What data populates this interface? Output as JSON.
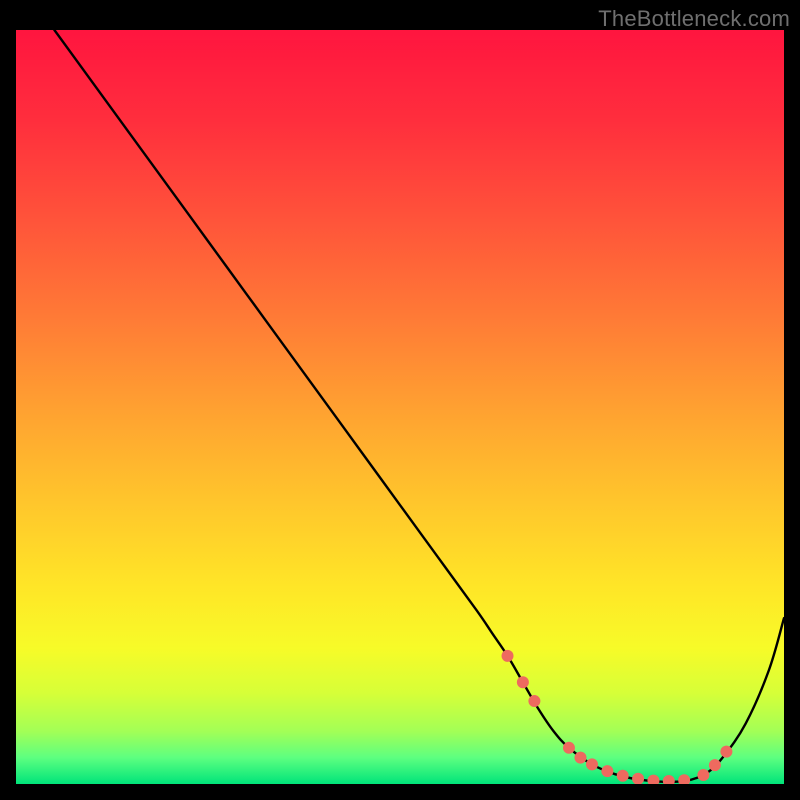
{
  "watermark": "TheBottleneck.com",
  "chart_data": {
    "type": "line",
    "title": "",
    "xlabel": "",
    "ylabel": "",
    "xlim": [
      0,
      100
    ],
    "ylim": [
      0,
      100
    ],
    "grid": false,
    "legend": false,
    "background_gradient": {
      "stops": [
        {
          "offset": 0.0,
          "color": "#ff153f"
        },
        {
          "offset": 0.12,
          "color": "#ff2e3d"
        },
        {
          "offset": 0.25,
          "color": "#ff533a"
        },
        {
          "offset": 0.38,
          "color": "#ff7a36"
        },
        {
          "offset": 0.5,
          "color": "#ffa031"
        },
        {
          "offset": 0.62,
          "color": "#ffc42c"
        },
        {
          "offset": 0.74,
          "color": "#ffe627"
        },
        {
          "offset": 0.82,
          "color": "#f7fb28"
        },
        {
          "offset": 0.88,
          "color": "#d6ff38"
        },
        {
          "offset": 0.93,
          "color": "#a3ff56"
        },
        {
          "offset": 0.965,
          "color": "#5dff80"
        },
        {
          "offset": 1.0,
          "color": "#00e47a"
        }
      ]
    },
    "series": [
      {
        "name": "bottleneck-curve",
        "stroke": "#000000",
        "stroke_width": 2.4,
        "x": [
          5,
          10,
          15,
          20,
          25,
          30,
          35,
          40,
          45,
          50,
          55,
          60,
          62,
          64,
          66,
          68,
          70,
          72,
          75,
          78,
          81,
          84,
          86,
          88,
          90,
          92,
          95,
          98,
          100
        ],
        "y": [
          100,
          93,
          86,
          79,
          72,
          65,
          58,
          51,
          44,
          37,
          30,
          23,
          20,
          17,
          13.5,
          10,
          7,
          4.8,
          2.6,
          1.3,
          0.6,
          0.3,
          0.3,
          0.6,
          1.5,
          3.5,
          8,
          15,
          22
        ]
      }
    ],
    "markers": {
      "name": "highlight-dots",
      "color": "#ee6a5f",
      "radius": 6,
      "points": [
        {
          "x": 64,
          "y": 17
        },
        {
          "x": 66,
          "y": 13.5
        },
        {
          "x": 67.5,
          "y": 11
        },
        {
          "x": 72,
          "y": 4.8
        },
        {
          "x": 73.5,
          "y": 3.5
        },
        {
          "x": 75,
          "y": 2.6
        },
        {
          "x": 77,
          "y": 1.7
        },
        {
          "x": 79,
          "y": 1.1
        },
        {
          "x": 81,
          "y": 0.7
        },
        {
          "x": 83,
          "y": 0.45
        },
        {
          "x": 85,
          "y": 0.4
        },
        {
          "x": 87,
          "y": 0.5
        },
        {
          "x": 89.5,
          "y": 1.2
        },
        {
          "x": 91,
          "y": 2.5
        },
        {
          "x": 92.5,
          "y": 4.3
        }
      ]
    }
  }
}
